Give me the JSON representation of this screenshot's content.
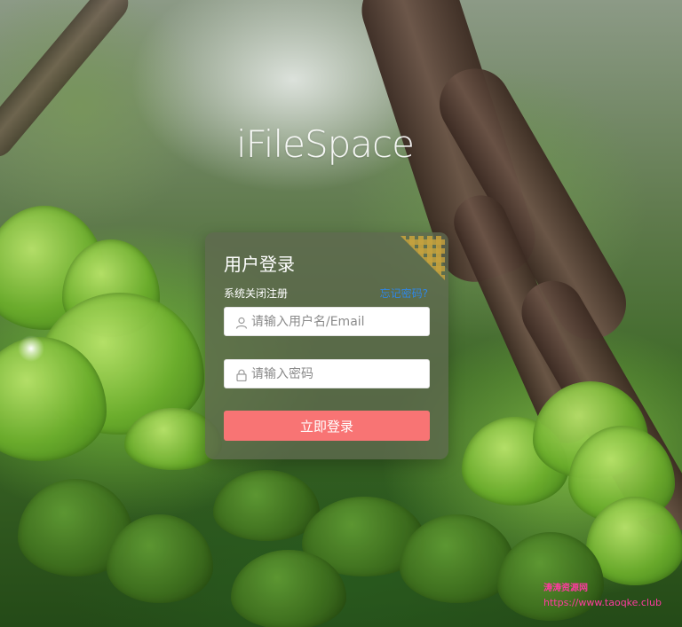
{
  "brand": {
    "name": "iFileSpace"
  },
  "login": {
    "title": "用户登录",
    "register_closed": "系统关闭注册",
    "forgot_password": "忘记密码?",
    "username_placeholder": "请输入用户名/Email",
    "password_placeholder": "请输入密码",
    "submit_label": "立即登录",
    "accent_color": "#f87474",
    "link_color": "#2f86e6"
  },
  "icons": {
    "username": "user-icon",
    "password": "lock-icon",
    "qr": "qr-code-icon"
  },
  "watermark": {
    "text": "涛涛资源网",
    "url": "https://www.taoqke.club",
    "color": "#ff3aa0"
  }
}
